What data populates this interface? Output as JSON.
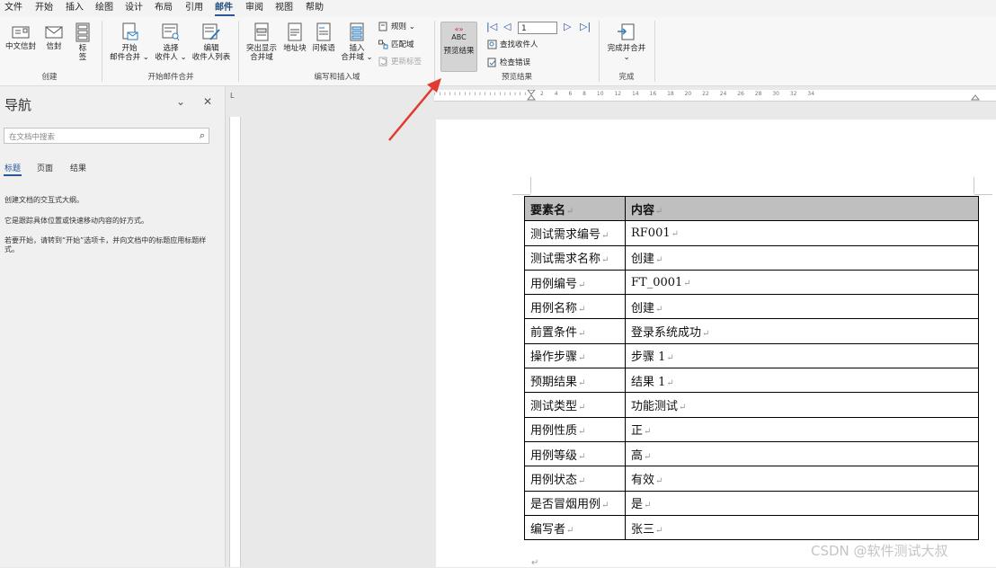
{
  "menu": {
    "items": [
      "文件",
      "开始",
      "插入",
      "绘图",
      "设计",
      "布局",
      "引用",
      "邮件",
      "审阅",
      "视图",
      "帮助"
    ],
    "active": "邮件"
  },
  "ribbon": {
    "create": {
      "envelope_cn": "中文信封",
      "envelope": "信封",
      "labels": "标签",
      "group": "创建"
    },
    "start_merge": {
      "start_line1": "开始",
      "start_line2": "邮件合并 ⌄",
      "select_line1": "选择",
      "select_line2": "收件人 ⌄",
      "edit_line1": "编辑",
      "edit_line2": "收件人列表",
      "group": "开始邮件合并"
    },
    "write_insert": {
      "highlight_line1": "突出显示",
      "highlight_line2": "合并域",
      "address_block": "地址块",
      "greeting": "问候语",
      "insert_line1": "插入",
      "insert_line2": "合并域 ⌄",
      "rules": "规则 ⌄",
      "match_fields": "匹配域",
      "update_labels": "更新标签",
      "group": "编写和插入域"
    },
    "preview": {
      "abc": "ABC",
      "preview_results": "预览结果",
      "record_number": "1",
      "find_recipient": "查找收件人",
      "check_errors": "检查错误",
      "group": "预览结果"
    },
    "finish": {
      "finish_merge": "完成并合并",
      "caret": "⌄",
      "group": "完成"
    }
  },
  "nav_pane": {
    "title": "导航",
    "collapse": "⌄",
    "close": "✕",
    "search_placeholder": "在文档中搜索",
    "search_icon": "⌕",
    "tabs": [
      "标题",
      "页面",
      "结果"
    ],
    "text1": "创建文档的交互式大纲。",
    "text2": "它是跟踪具体位置或快速移动内容的好方式。",
    "text3": "若要开始，请转到“开始”选项卡，并向文档中的标题应用标题样式。"
  },
  "ruler": {
    "corner": "L",
    "hruler_numbers": "2 4 6 8 10 12 14 16 18 20 22 24 26 28 30 32 34"
  },
  "document": {
    "header": [
      "要素名",
      "内容"
    ],
    "rows": [
      [
        "测试需求编号",
        "RF001"
      ],
      [
        "测试需求名称",
        "创建"
      ],
      [
        "用例编号",
        "FT_0001"
      ],
      [
        "用例名称",
        "创建"
      ],
      [
        "前置条件",
        "登录系统成功"
      ],
      [
        "操作步骤",
        "步骤 1"
      ],
      [
        "预期结果",
        "结果 1"
      ],
      [
        "测试类型",
        "功能测试"
      ],
      [
        "用例性质",
        "正"
      ],
      [
        "用例等级",
        "高"
      ],
      [
        "用例状态",
        "有效"
      ],
      [
        "是否冒烟用例",
        "是"
      ],
      [
        "编写者",
        "张三"
      ]
    ],
    "para_mark": "↵"
  },
  "watermark": "CSDN @软件测试大叔",
  "colors": {
    "arrow": "#e23a2e",
    "accent": "#2b579a",
    "header_fill": "#bfbfbf"
  }
}
